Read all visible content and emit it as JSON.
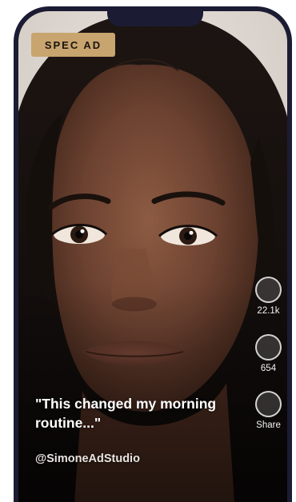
{
  "ad": {
    "badge": "SPEC AD",
    "caption": "\"This changed my morning routine...\"",
    "handle": "@SimoneAdStudio"
  },
  "actions": [
    {
      "icon": "like-icon",
      "count": "22.1k"
    },
    {
      "icon": "comment-icon",
      "count": "654"
    },
    {
      "icon": "share-icon",
      "count": "Share"
    }
  ],
  "colors": {
    "phone_frame": "#1b1c33",
    "badge_bg": "#c8a46e",
    "text": "#ffffff"
  }
}
